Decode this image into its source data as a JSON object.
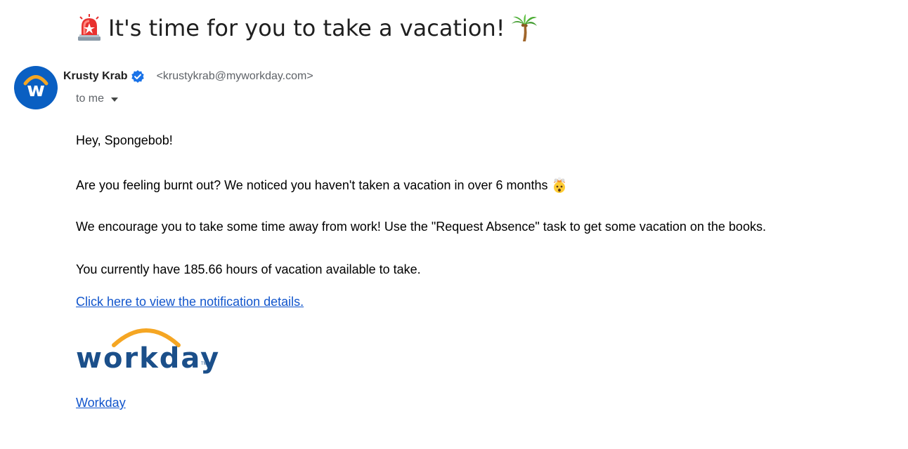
{
  "email": {
    "subject": "It's time for you to take a vacation!",
    "subject_leading_icon": "siren-icon",
    "subject_trailing_icon": "palm-tree-icon",
    "sender": {
      "name": "Krusty Krab",
      "email": "<krustykrab@myworkday.com>",
      "avatar_letter": "w",
      "verified": true
    },
    "recipient_label": "to me",
    "body": {
      "greeting": "Hey, Spongebob!",
      "burnout": "Are you feeling burnt out? We noticed you haven't taken a vacation in over 6 months",
      "encourage": "We encourage you to take some time away from work! Use the \"Request Absence\" task to get some vacation on the books.",
      "hours": "You currently have 185.66 hours of vacation available to take.",
      "details_link": "Click here to view the notification details.",
      "logo_text": "workday",
      "logo_tm": "TM",
      "footer_link": "Workday"
    }
  },
  "colors": {
    "avatar_bg": "#0a5fc2",
    "accent_orange": "#f5a623",
    "link_blue": "#1155cc",
    "logo_blue": "#1b4f8a",
    "verified_blue": "#1a73e8"
  }
}
